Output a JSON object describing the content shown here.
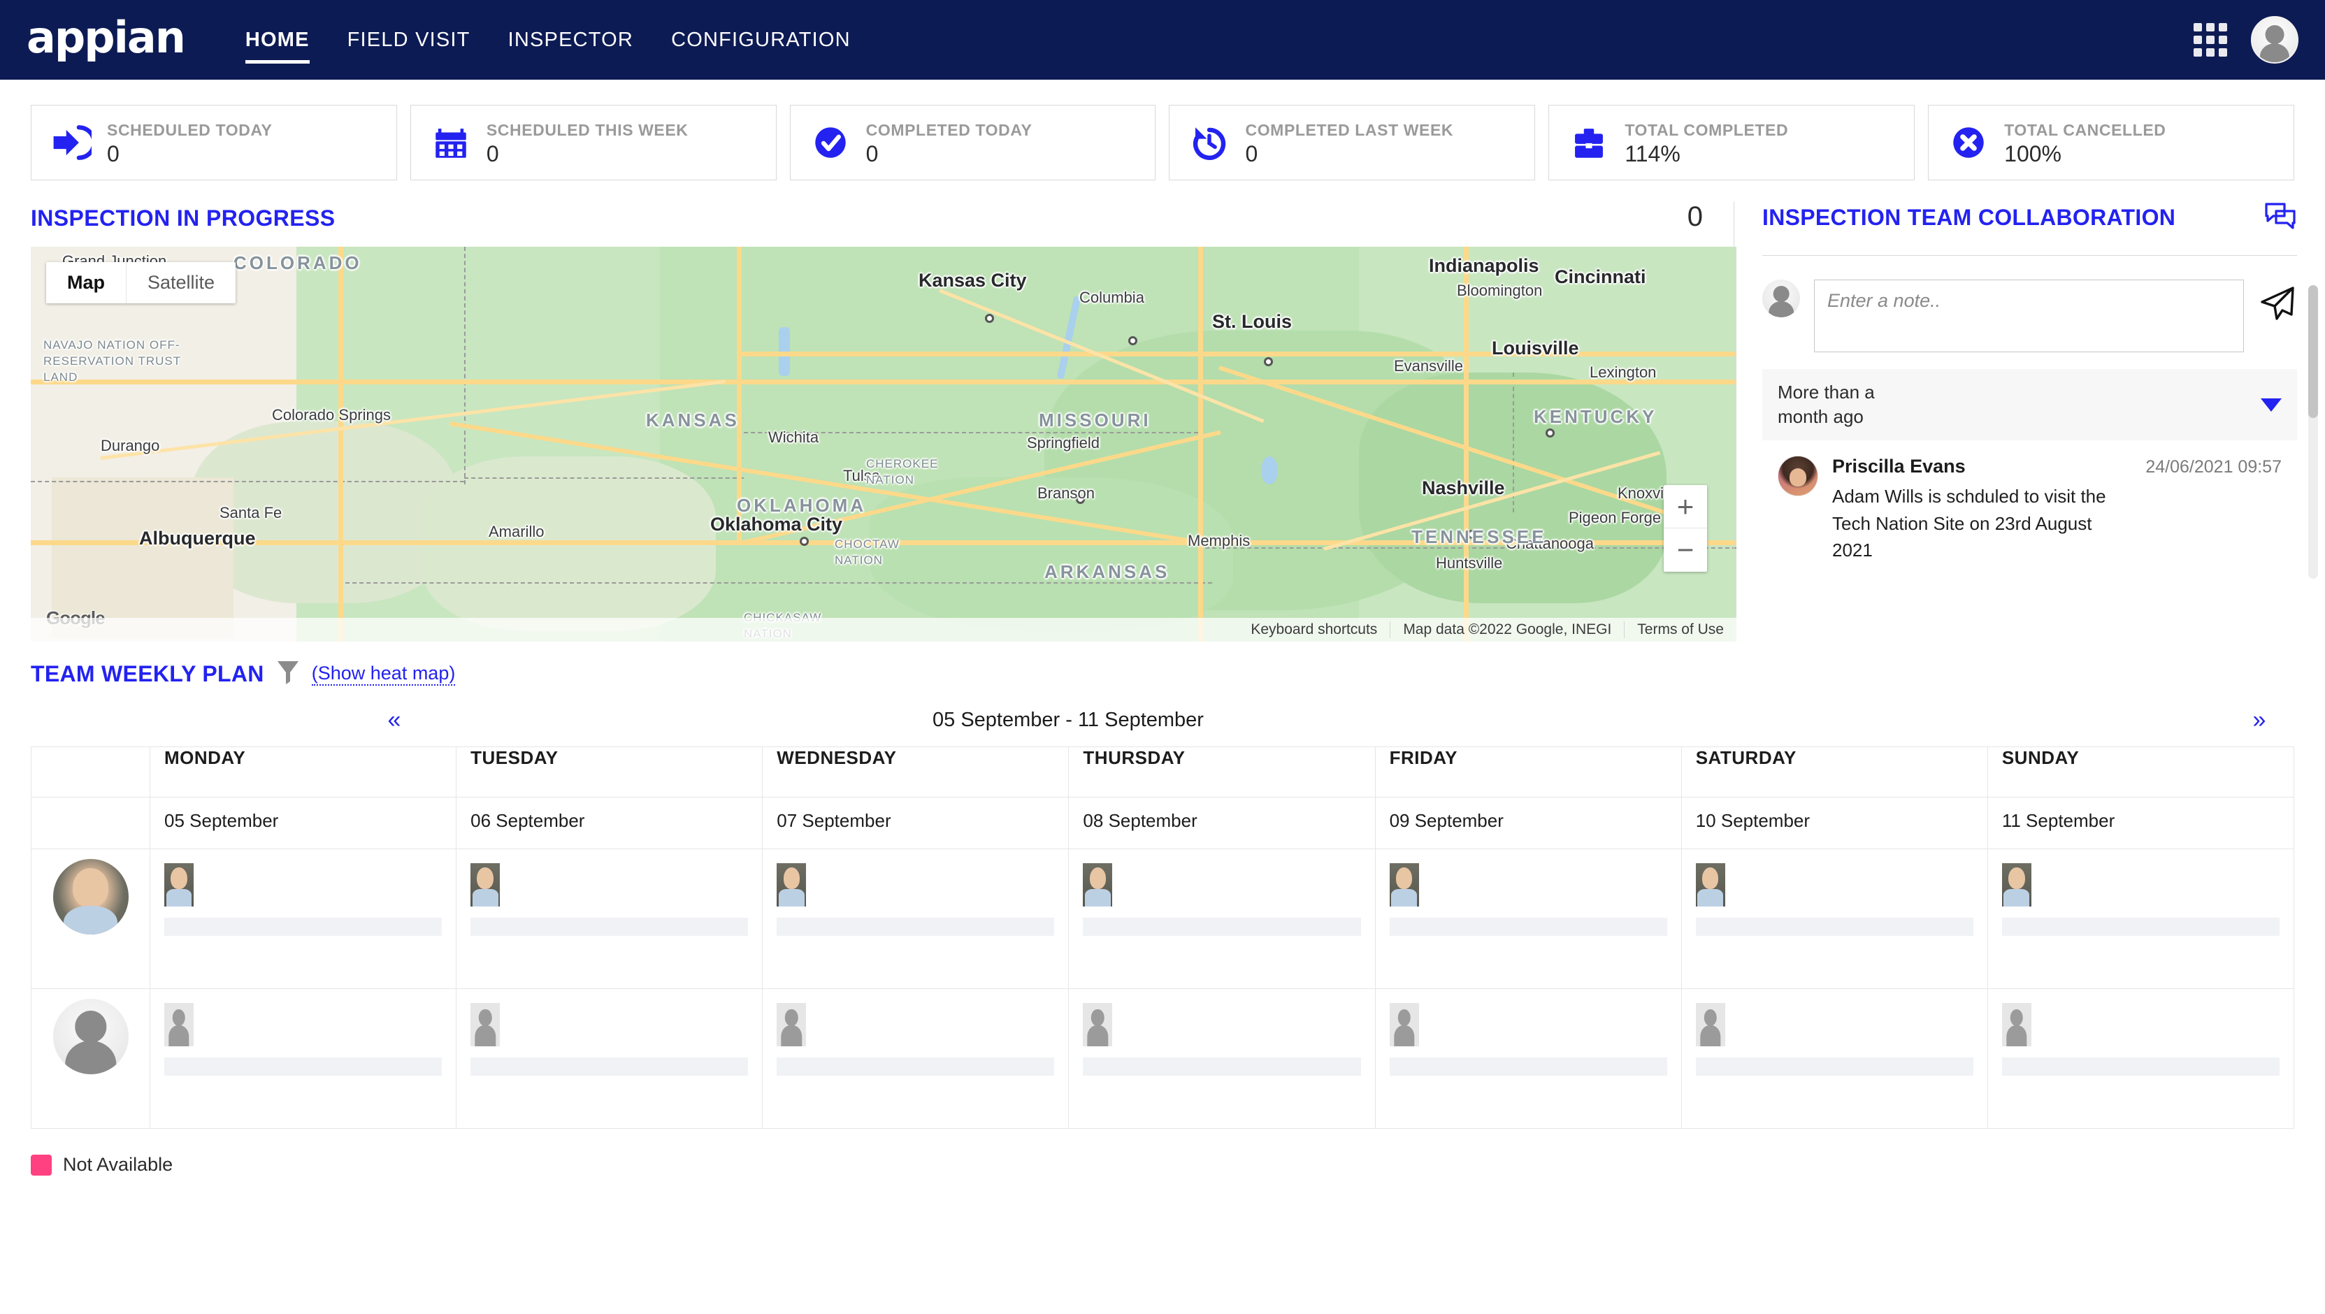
{
  "header": {
    "logo": "appian",
    "nav": [
      {
        "label": "HOME",
        "active": true
      },
      {
        "label": "FIELD VISIT",
        "active": false
      },
      {
        "label": "INSPECTOR",
        "active": false
      },
      {
        "label": "CONFIGURATION",
        "active": false
      }
    ],
    "grid_icon": "apps-grid-icon",
    "avatar": "user-avatar",
    "bg_color": "#0d1b54"
  },
  "kpis": [
    {
      "label": "SCHEDULED TODAY",
      "value": "0",
      "icon": "arrow-into-door-icon"
    },
    {
      "label": "SCHEDULED THIS WEEK",
      "value": "0",
      "icon": "calendar-icon"
    },
    {
      "label": "COMPLETED TODAY",
      "value": "0",
      "icon": "check-circle-icon"
    },
    {
      "label": "COMPLETED LAST WEEK",
      "value": "0",
      "icon": "history-clock-icon"
    },
    {
      "label": "TOTAL COMPLETED",
      "value": "114%",
      "icon": "briefcase-icon"
    },
    {
      "label": "TOTAL CANCELLED",
      "value": "100%",
      "icon": "x-circle-icon"
    }
  ],
  "accent_color": "#2322f0",
  "inspection": {
    "title": "INSPECTION IN PROGRESS",
    "count": "0",
    "map": {
      "type_buttons": [
        {
          "label": "Map",
          "selected": true
        },
        {
          "label": "Satellite",
          "selected": false
        }
      ],
      "zoom_in": "+",
      "zoom_out": "−",
      "logo": "Google",
      "footer": [
        "Keyboard shortcuts",
        "Map data ©2022 Google, INEGI",
        "Terms of Use"
      ],
      "cities": [
        "Kansas City",
        "Columbia",
        "St. Louis",
        "Indianapolis",
        "Bloomington",
        "Cincinnati",
        "Louisville",
        "Lexington",
        "Evansville",
        "Springfield",
        "Branson",
        "Nashville",
        "Knoxville",
        "Pigeon Forge",
        "Memphis",
        "Chattanooga",
        "Huntsville",
        "Tulsa",
        "Oklahoma City",
        "Amarillo",
        "Wichita",
        "Santa Fe",
        "Albuquerque",
        "Durango",
        "Grand Junction",
        "Colorado Springs"
      ],
      "states": [
        "COLORADO",
        "KANSAS",
        "MISSOURI",
        "KENTUCKY",
        "TENNESSEE",
        "OKLAHOMA",
        "ARKANSAS"
      ],
      "reservations": [
        "NAVAJO NATION OFF-RESERVATION TRUST LAND",
        "CHEROKEE NATION",
        "CHOCTAW NATION",
        "CHICKASAW NATION"
      ]
    }
  },
  "collaboration": {
    "title": "INSPECTION TEAM COLLABORATION",
    "header_icon": "chat-bubbles-icon",
    "note_placeholder": "Enter a note..",
    "note_value": "",
    "send_icon": "send-paper-plane-icon",
    "group": {
      "label": "More than a\nmonth ago",
      "label_line1": "More than a",
      "label_line2": "month ago",
      "caret_icon": "chevron-down-icon",
      "expanded": true
    },
    "comments": [
      {
        "author": "Priscilla Evans",
        "timestamp": "24/06/2021 09:57",
        "text": "Adam Wills is schduled to visit the Tech Nation Site on 23rd August 2021",
        "avatar": "priscilla-avatar"
      }
    ]
  },
  "weekly_plan": {
    "title": "TEAM WEEKLY PLAN",
    "filter_icon": "funnel-filter-icon",
    "heat_map_link": "(Show heat map)",
    "prev_label": "«",
    "next_label": "»",
    "week_range": "05 September - 11 September",
    "columns": [
      "",
      "MONDAY",
      "TUESDAY",
      "WEDNESDAY",
      "THURSDAY",
      "FRIDAY",
      "SATURDAY",
      "SUNDAY"
    ],
    "dates": [
      "",
      "05 September",
      "06 September",
      "07 September",
      "08 September",
      "09 September",
      "10 September",
      "11 September"
    ],
    "rows": [
      {
        "avatar": "inspector-photo-avatar",
        "avatar_type": "photo",
        "cells": [
          {
            "mini_avatar": "photo",
            "bar": true
          },
          {
            "mini_avatar": "photo",
            "bar": true
          },
          {
            "mini_avatar": "photo",
            "bar": true
          },
          {
            "mini_avatar": "photo",
            "bar": true
          },
          {
            "mini_avatar": "photo",
            "bar": true
          },
          {
            "mini_avatar": "photo",
            "bar": true
          },
          {
            "mini_avatar": "photo",
            "bar": true
          }
        ]
      },
      {
        "avatar": "inspector-blank-avatar",
        "avatar_type": "blank",
        "cells": [
          {
            "mini_avatar": "blank",
            "bar": true
          },
          {
            "mini_avatar": "blank",
            "bar": true
          },
          {
            "mini_avatar": "blank",
            "bar": true
          },
          {
            "mini_avatar": "blank",
            "bar": true
          },
          {
            "mini_avatar": "blank",
            "bar": true
          },
          {
            "mini_avatar": "blank",
            "bar": true
          },
          {
            "mini_avatar": "blank",
            "bar": true
          }
        ]
      }
    ]
  },
  "legend": [
    {
      "label": "Not Available",
      "color": "#ff4081"
    }
  ]
}
